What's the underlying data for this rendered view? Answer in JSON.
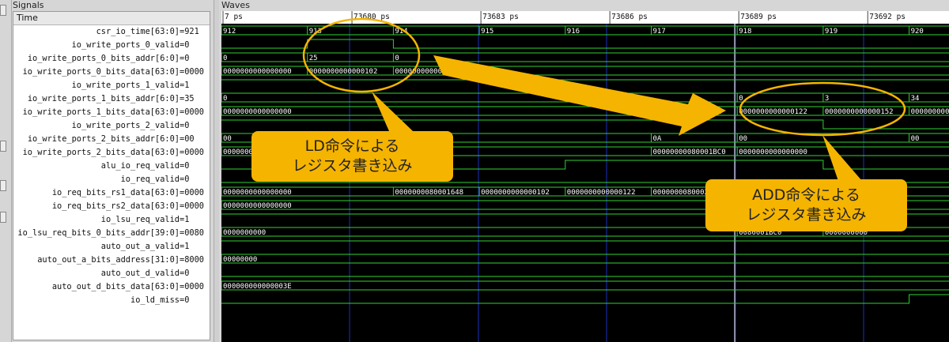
{
  "panels": {
    "signals_label": "Signals",
    "waves_label": "Waves"
  },
  "signals": {
    "header": "Time",
    "rows": [
      {
        "name": "csr_io_time[63:0]",
        "value": "=921"
      },
      {
        "name": "io_write_ports_0_valid",
        "value": "=0"
      },
      {
        "name": "io_write_ports_0_bits_addr[6:0]",
        "value": "=0"
      },
      {
        "name": "io_write_ports_0_bits_data[63:0]",
        "value": "=0000"
      },
      {
        "name": "io_write_ports_1_valid",
        "value": "=1"
      },
      {
        "name": "io_write_ports_1_bits_addr[6:0]",
        "value": "=35"
      },
      {
        "name": "io_write_ports_1_bits_data[63:0]",
        "value": "=0000"
      },
      {
        "name": "io_write_ports_2_valid",
        "value": "=0"
      },
      {
        "name": "io_write_ports_2_bits_addr[6:0]",
        "value": "=00"
      },
      {
        "name": "io_write_ports_2_bits_data[63:0]",
        "value": "=0000"
      },
      {
        "name": "alu_io_req_valid",
        "value": "=0"
      },
      {
        "name": "io_req_valid",
        "value": "=0"
      },
      {
        "name": "io_req_bits_rs1_data[63:0]",
        "value": "=0000"
      },
      {
        "name": "io_req_bits_rs2_data[63:0]",
        "value": "=0000"
      },
      {
        "name": "io_lsu_req_valid",
        "value": "=1"
      },
      {
        "name": "io_lsu_req_bits_0_bits_addr[39:0]",
        "value": "=0080"
      },
      {
        "name": "auto_out_a_valid",
        "value": "=1"
      },
      {
        "name": "auto_out_a_bits_address[31:0]",
        "value": "=8000"
      },
      {
        "name": "auto_out_d_valid",
        "value": "=0"
      },
      {
        "name": "auto_out_d_bits_data[63:0]",
        "value": "=0000"
      },
      {
        "name": "io_ld_miss",
        "value": "=0"
      }
    ]
  },
  "timeline": {
    "ticks": [
      {
        "t": "7 ps"
      },
      {
        "t": "73680 ps"
      },
      {
        "t": "73683 ps"
      },
      {
        "t": "73686 ps"
      },
      {
        "t": "73689 ps"
      },
      {
        "t": "73692 ps"
      }
    ]
  },
  "waves": [
    {
      "kind": "bus",
      "segs": [
        [
          "912",
          0
        ],
        [
          "913",
          1
        ],
        [
          "914",
          2
        ],
        [
          "915",
          3
        ],
        [
          "916",
          4
        ],
        [
          "917",
          5
        ],
        [
          "918",
          6
        ],
        [
          "919",
          7
        ],
        [
          "920",
          8
        ]
      ]
    },
    {
      "kind": "bit",
      "levels": [
        0,
        1,
        0,
        0,
        0,
        0,
        0,
        0,
        0
      ]
    },
    {
      "kind": "bus",
      "segs": [
        [
          "0",
          0
        ],
        [
          "25",
          1
        ],
        [
          "0",
          2
        ]
      ]
    },
    {
      "kind": "bus",
      "segs": [
        [
          "0000000000000000",
          0
        ],
        [
          "0000000000000102",
          1
        ],
        [
          "0000000000000000",
          2
        ]
      ]
    },
    {
      "kind": "bit",
      "levels": [
        1,
        1,
        1,
        1,
        1,
        1,
        1,
        1,
        1
      ]
    },
    {
      "kind": "bus",
      "segs": [
        [
          "0",
          0
        ],
        [
          "16",
          4
        ],
        [
          "0",
          6
        ],
        [
          "3",
          7
        ],
        [
          "34",
          8
        ]
      ]
    },
    {
      "kind": "bus",
      "segs": [
        [
          "0000000000000000",
          0
        ],
        [
          "00000000000007AE",
          5
        ],
        [
          "0000000000000122",
          6
        ],
        [
          "0000000000000152",
          7
        ],
        [
          "0000000000000000",
          8
        ]
      ]
    },
    {
      "kind": "bit",
      "levels": [
        1,
        1,
        1,
        1,
        1,
        1,
        1,
        0,
        0
      ]
    },
    {
      "kind": "bus",
      "segs": [
        [
          "00",
          0
        ],
        [
          "0A",
          5
        ],
        [
          "00",
          6
        ],
        [
          "00",
          8
        ]
      ]
    },
    {
      "kind": "bus",
      "segs": [
        [
          "0000000000000000",
          0
        ],
        [
          "00000000080001BC0",
          5
        ],
        [
          "0000000000000000",
          6
        ]
      ]
    },
    {
      "kind": "bit",
      "levels": [
        0,
        0,
        0,
        0,
        1,
        1,
        1,
        0,
        0
      ]
    },
    {
      "kind": "bit",
      "levels": [
        0,
        0,
        0,
        0,
        0,
        0,
        0,
        0,
        0
      ]
    },
    {
      "kind": "bus",
      "segs": [
        [
          "0000000000000000",
          0
        ],
        [
          "0000000080001648",
          2
        ],
        [
          "0000000000000102",
          3
        ],
        [
          "0000000000000122",
          4
        ],
        [
          "0000000080002000",
          5
        ]
      ]
    },
    {
      "kind": "bus",
      "segs": [
        [
          "0000000000000000",
          0
        ]
      ]
    },
    {
      "kind": "bit",
      "levels": [
        1,
        1,
        1,
        1,
        1,
        1,
        1,
        1,
        1
      ]
    },
    {
      "kind": "bus",
      "segs": [
        [
          "0000000000",
          0
        ],
        [
          "0080001BC0",
          6
        ],
        [
          "0000000000",
          7
        ]
      ]
    },
    {
      "kind": "bit",
      "levels": [
        1,
        1,
        1,
        1,
        1,
        1,
        1,
        1,
        1
      ]
    },
    {
      "kind": "bus",
      "segs": [
        [
          "00000000",
          0
        ]
      ]
    },
    {
      "kind": "bit",
      "levels": [
        0,
        0,
        0,
        0,
        0,
        0,
        0,
        0,
        0
      ]
    },
    {
      "kind": "bus",
      "segs": [
        [
          "000000000000003E",
          0
        ]
      ]
    },
    {
      "kind": "bit",
      "levels": [
        0,
        0,
        0,
        0,
        0,
        0,
        0,
        0,
        1
      ]
    }
  ],
  "annotations": {
    "callout_ld": [
      "LD命令による",
      "レジスタ書き込み"
    ],
    "callout_add": [
      "ADD命令による",
      "レジスタ書き込み"
    ],
    "annotation_color": "#f5b400",
    "wave_color": "#2fd22f",
    "wave_bg": "#000000"
  }
}
